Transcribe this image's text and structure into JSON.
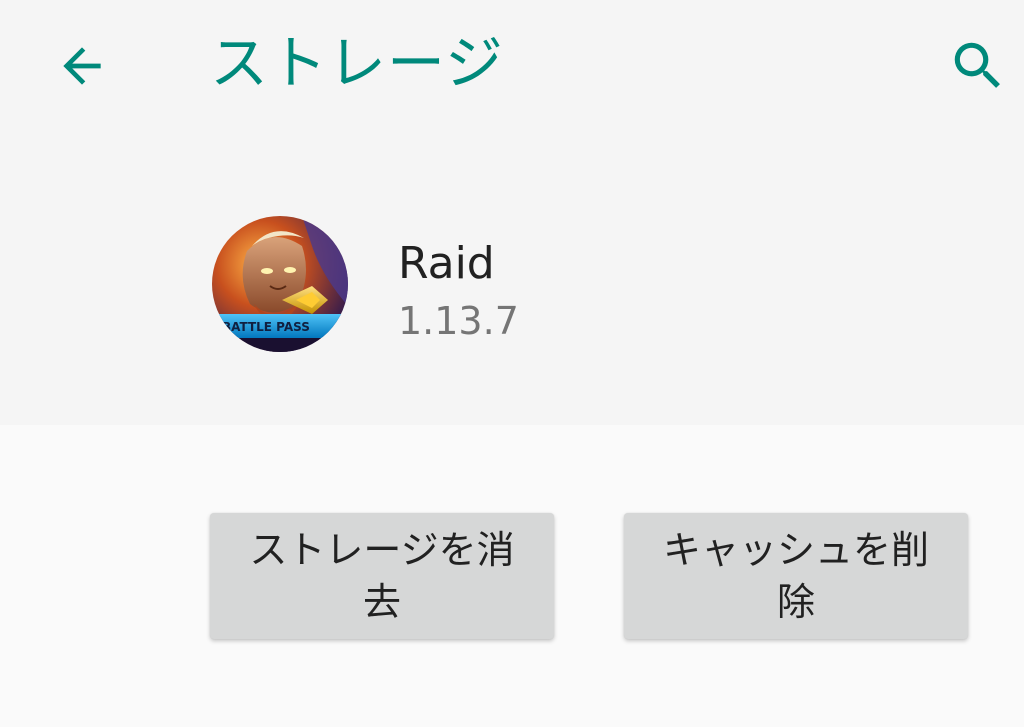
{
  "toolbar": {
    "title": "ストレージ",
    "back_icon": "arrow-left-icon",
    "search_icon": "search-icon",
    "accent_color": "#00897b"
  },
  "app": {
    "name": "Raid",
    "version": "1.13.7",
    "icon": "app-icon",
    "icon_badge_text": "BATTLE PASS"
  },
  "actions": {
    "clear_storage_line1": "ストレージを消",
    "clear_storage_line2": "去",
    "clear_cache_line1": "キャッシュを削",
    "clear_cache_line2": "除"
  }
}
